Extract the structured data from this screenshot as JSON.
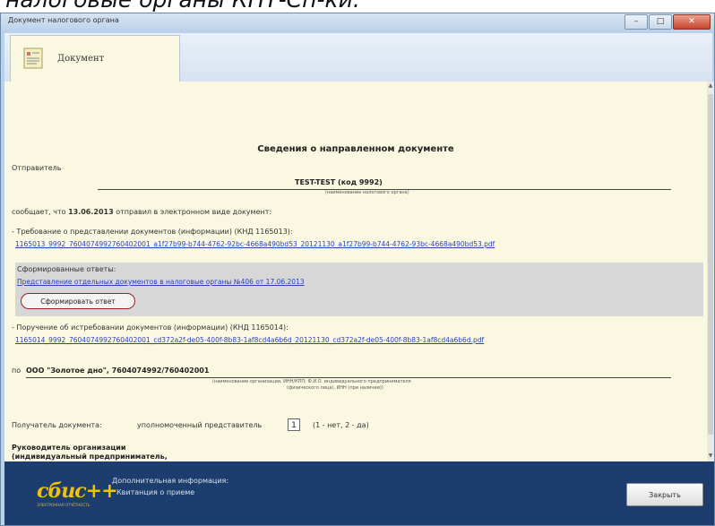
{
  "caption": "налоговые органы КНТ-Сп-ки.",
  "window": {
    "title": "Документ налогового органа"
  },
  "tab": {
    "label": "Документ"
  },
  "doc": {
    "heading": "Сведения о направленном документе",
    "sender_label": "Отправитель",
    "sender_name": "TEST-TEST (код 9992)",
    "sender_caption": "(наименование налогового органа)",
    "reported_prefix": "сообщает, что",
    "reported_date": "13.06.2013",
    "reported_suffix": "отправил в электронном виде документ:",
    "doc1_title": "- Требование о представлении документов (информации) (КНД 1165013):",
    "doc1_link": "1165013_9992_7604074992760402001_a1f27b99-b744-4762-92bc-4668a490bd53_20121130_a1f27b99-b744-4762-93bc-4668a490bd53.pdf",
    "replies_label": "Сформированные ответы:",
    "replies_link": "Представление отдельных документов в налоговые органы №406 от 17.06.2013",
    "form_reply_button": "Сформировать ответ",
    "doc2_title": "- Поручение об истребовании документов (информации) (КНД 1165014):",
    "doc2_link": "1165014_9992_7604074992760402001_cd372a2f-de05-400f-8b83-1af8cd4a6b6d_20121130_cd372a2f-de05-400f-8b83-1af8cd4a6b6d.pdf",
    "to_prefix": "по",
    "org_name": "ООО \"Золотое дно\", 7604074992/760402001",
    "org_caption1": "(наименование организации, ИНН/КПП; Ф.И.О. индивидуального предпринимателя",
    "org_caption2": "(физического лица), ИНН (при наличии))",
    "recipient_label": "Получатель документа:",
    "recipient_value": "уполномоченный представитель",
    "recipient_code": "1",
    "recipient_hint": "(1 - нет, 2 - да)",
    "head_line1": "Руководитель организации",
    "head_line2": "(индивидуальный предприниматель,"
  },
  "footer": {
    "logo": "сбис++",
    "logo_sub": "ЭЛЕКТРОННАЯ ОТЧЁТНОСТЬ",
    "info1": "Дополнительная информация:",
    "info2": "Квитанция о приеме",
    "close_button": "Закрыть"
  }
}
